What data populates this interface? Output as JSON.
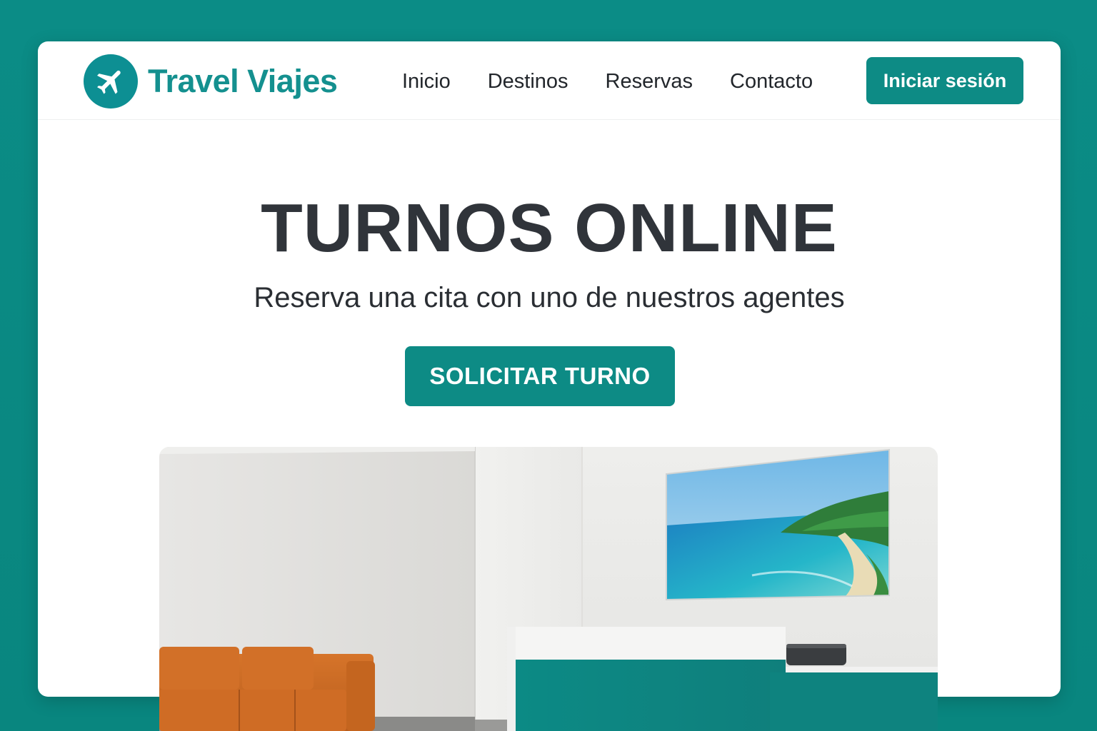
{
  "brand": {
    "name": "Travel Viajes",
    "icon": "airplane-icon",
    "color": "#14908f"
  },
  "nav": {
    "items": [
      {
        "label": "Inicio"
      },
      {
        "label": "Destinos"
      },
      {
        "label": "Reservas"
      },
      {
        "label": "Contacto"
      }
    ],
    "login_label": "Iniciar sesión"
  },
  "hero": {
    "title": "TURNOS ONLINE",
    "subtitle": "Reserva una cita con uno de nuestros agentes",
    "cta_label": "SOLICITAR TURNO"
  },
  "photo": {
    "subject": "travel-agency-office-reception"
  },
  "colors": {
    "accent": "#0d8b85",
    "background": "#0a8a84",
    "title_text": "#30343a"
  }
}
